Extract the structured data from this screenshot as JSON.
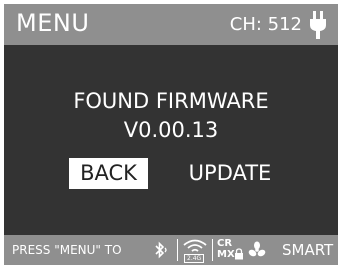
{
  "header": {
    "title": "MENU",
    "channel": "CH: 512",
    "power_icon": "plug-icon"
  },
  "dialog": {
    "message": "FOUND FIRMWARE",
    "version": "V0.00.13",
    "back_label": "BACK",
    "update_label": "UPDATE",
    "selected": "BACK"
  },
  "footer": {
    "hint": "PRESS \"MENU\" TO",
    "badge_24g": "2.4G",
    "crmx_top": "CR",
    "crmx_bottom": "MX",
    "smart_label": "SMART",
    "icons": [
      "bluetooth-icon",
      "wifi-2.4g-icon",
      "crmx-icon",
      "fan-icon"
    ]
  },
  "colors": {
    "header_bg": "#8f8f8f",
    "body_bg": "#333333",
    "text": "#ffffff",
    "selected_bg": "#ffffff",
    "selected_text": "#222222"
  }
}
